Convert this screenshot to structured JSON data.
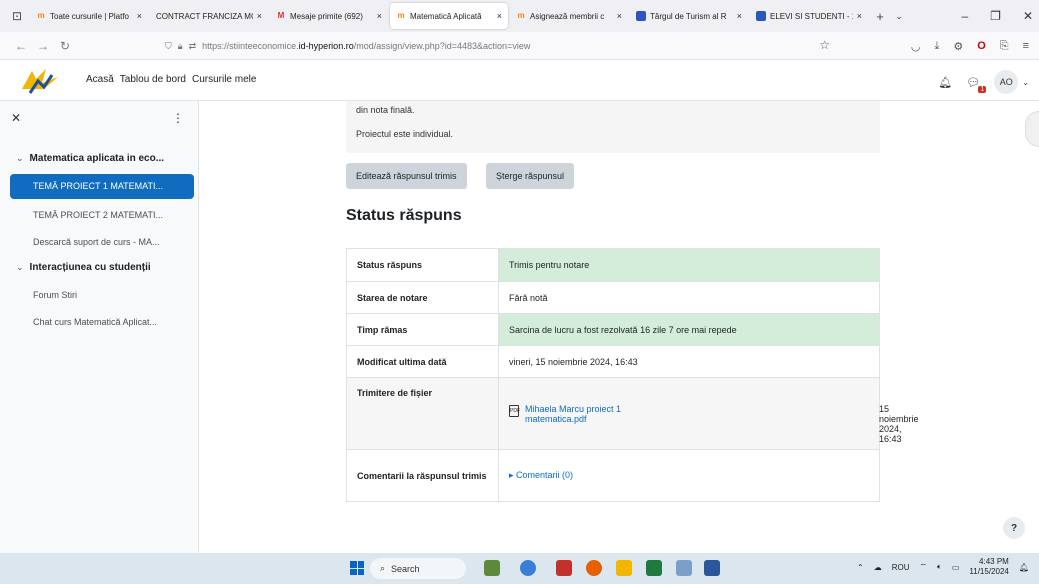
{
  "browser": {
    "tabs": [
      {
        "label": "Toate cursurile | Platfo",
        "fav": "m",
        "fav_kind": "moodle",
        "active": false
      },
      {
        "label": "CONTRACT FRANCIZA MC",
        "fav": "",
        "fav_kind": "none",
        "active": false
      },
      {
        "label": "Mesaje primite (692)",
        "fav": "M",
        "fav_kind": "gmail",
        "active": false
      },
      {
        "label": "Matematică Aplicată",
        "fav": "m",
        "fav_kind": "moodle",
        "active": true
      },
      {
        "label": "Asignează membrii c",
        "fav": "m",
        "fav_kind": "moodle",
        "active": false
      },
      {
        "label": "Târgul de Turism al R",
        "fav": "",
        "fav_kind": "ms",
        "active": false
      },
      {
        "label": "ELEVI SI STUDENTI - 1",
        "fav": "",
        "fav_kind": "ms",
        "active": false
      }
    ],
    "tab_close": "×",
    "new_tab": "+",
    "url_prefix": "https://stiinteeconomice.",
    "url_domain": "id-hyperion.ro",
    "url_path": "/mod/assign/view.php?id=4483&action=view"
  },
  "header": {
    "nav": [
      "Acasă",
      "Tablou de bord",
      "Cursurile mele"
    ],
    "avatar_initials": "AO",
    "message_badge": "1"
  },
  "drawer": {
    "sections": [
      {
        "label": "Matematica aplicata in eco..."
      },
      {
        "label": "Interacțiunea cu studenții"
      }
    ],
    "items": [
      {
        "label": "TEMĂ PROIECT 1 MATEMATI..."
      },
      {
        "label": "TEMĂ PROIECT 2 MATEMATI..."
      },
      {
        "label": "Descarcă suport de curs - MA..."
      },
      {
        "label": "Forum Stiri"
      },
      {
        "label": "Chat curs Matematică Aplicat..."
      }
    ]
  },
  "main": {
    "desc_line1": "din nota finală.",
    "desc_line2": "Proiectul este individual.",
    "edit_button": "Editează răspunsul trimis",
    "delete_button": "Șterge răspunsul",
    "status_heading": "Status răspuns",
    "rows": [
      {
        "key": "Status răspuns",
        "value": "Trimis pentru notare"
      },
      {
        "key": "Starea de notare",
        "value": "Fără notă"
      },
      {
        "key": "Timp rămas",
        "value": "Sarcina de lucru a fost rezolvată 16 zile 7 ore mai repede"
      },
      {
        "key": "Modificat ultima dată",
        "value": "vineri, 15 noiembrie 2024, 16:43"
      },
      {
        "key": "Trimitere de fișier",
        "file_name_1": "Mihaela Marcu proiect 1",
        "file_name_2": "matematica.pdf",
        "file_date": "15 noiembrie 2024, 16:43"
      },
      {
        "key": "Comentarii la răspunsul trimis",
        "value": "Comentarii (0)"
      }
    ],
    "help": "?"
  },
  "taskbar": {
    "search": "Search",
    "lang": "ROU",
    "time": "4:43 PM",
    "date": "11/15/2024"
  },
  "colors": {
    "accent": "#0f6cbf",
    "success_bg": "#d4edda"
  }
}
